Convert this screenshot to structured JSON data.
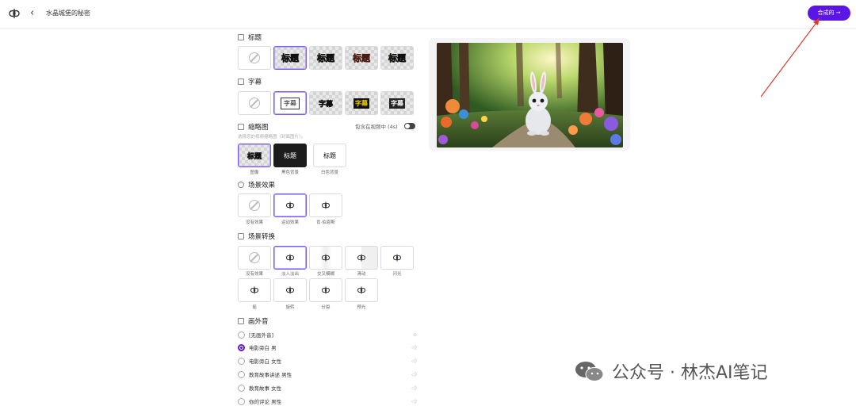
{
  "header": {
    "title": "水晶城堡的秘密",
    "back_icon": "‹",
    "next_label": "合成的 →"
  },
  "sections": {
    "title": {
      "heading": "标题",
      "options": [
        "标题",
        "标题",
        "标题",
        "标题"
      ]
    },
    "subtitle": {
      "heading": "字幕",
      "options": [
        "字幕",
        "字幕",
        "字幕",
        "字幕"
      ]
    },
    "thumbnail": {
      "heading": "缩略图",
      "hint": "选择您的视频缩略图（封面图片）。",
      "toggle_label": "包含在视频中 (4s)",
      "options": [
        {
          "text": "标题",
          "caption": "图像"
        },
        {
          "text": "标题",
          "caption": "黑色背景"
        },
        {
          "text": "标题",
          "caption": "白色背景"
        }
      ]
    },
    "scene_effect": {
      "heading": "场景效果",
      "captions": [
        "没有效果",
        "运动效果",
        "肯·伯恩斯"
      ]
    },
    "transition": {
      "heading": "场景转换",
      "captions": [
        "没有效果",
        "淡入淡出",
        "交叉模糊",
        "滑动",
        "闪光",
        "摇",
        "旋转",
        "分裂",
        "预光"
      ]
    },
    "voiceover": {
      "heading": "画外音",
      "items": [
        "[无画外音]",
        "电影旁白 男",
        "电影旁白 女性",
        "教育故事讲述 男性",
        "教育故事 女性",
        "你的评论 男性"
      ]
    }
  },
  "watermark": {
    "text": "公众号 · 林杰AI笔记"
  },
  "colors": {
    "accent": "#5b16e6",
    "selected_border": "#7c5cf0"
  }
}
